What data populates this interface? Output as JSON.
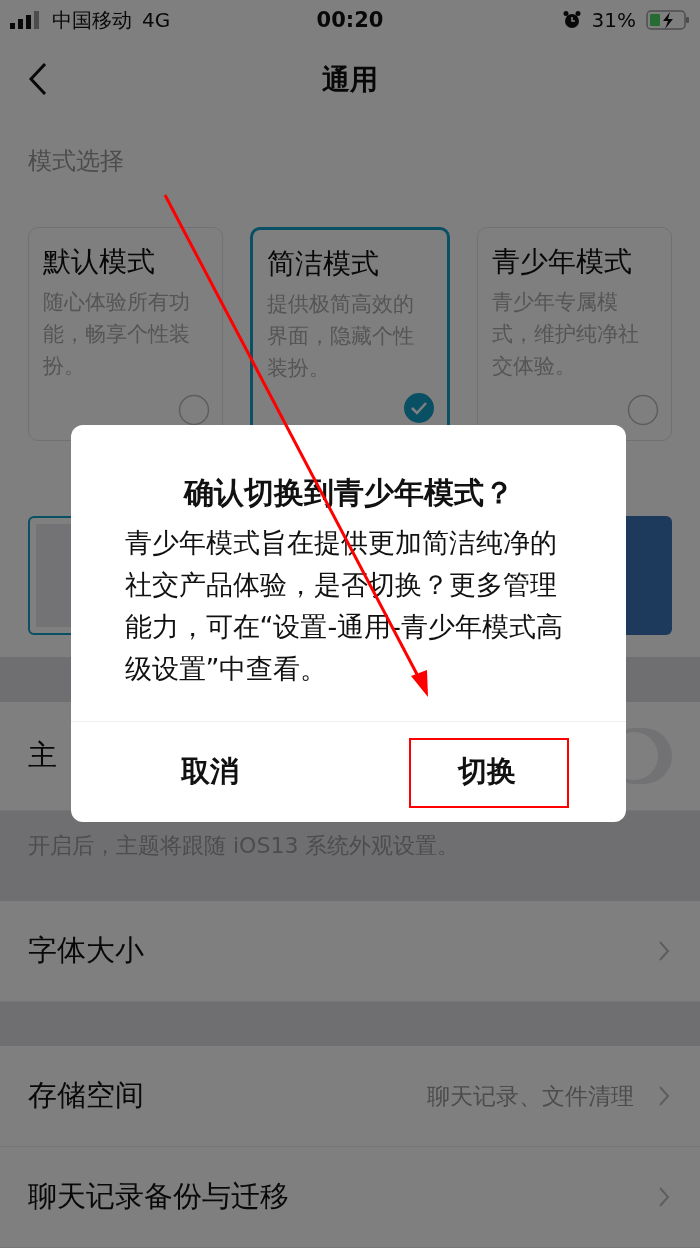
{
  "status_bar": {
    "carrier": "中国移动",
    "network": "4G",
    "time": "00:20",
    "battery": "31%"
  },
  "nav": {
    "title": "通用"
  },
  "section_title": "模式选择",
  "modes": [
    {
      "title": "默认模式",
      "description": "随心体验所有功能，畅享个性装扮。",
      "selected": false
    },
    {
      "title": "简洁模式",
      "description": "提供极简高效的界面，隐藏个性装扮。",
      "selected": true
    },
    {
      "title": "青少年模式",
      "description": "青少年专属模式，维护纯净社交体验。",
      "selected": false
    }
  ],
  "themes": [
    {
      "selected": true
    },
    {
      "selected": false
    }
  ],
  "theme_follow": {
    "label": "主",
    "on": false
  },
  "theme_note": "开启后，主题将跟随 iOS13 系统外观设置。",
  "setting_groups": [
    [
      {
        "label": "字体大小"
      }
    ],
    [
      {
        "label": "存储空间",
        "value": "聊天记录、文件清理"
      },
      {
        "label": "聊天记录备份与迁移"
      }
    ]
  ],
  "dialog": {
    "title": "确认切换到青少年模式？",
    "message": "青少年模式旨在提供更加简洁纯净的社交产品体验，是否切换？更多管理能力，可在“设置-通用-青少年模式高级设置”中查看。",
    "buttons": [
      {
        "label": "取消"
      },
      {
        "label": "切换"
      }
    ]
  }
}
